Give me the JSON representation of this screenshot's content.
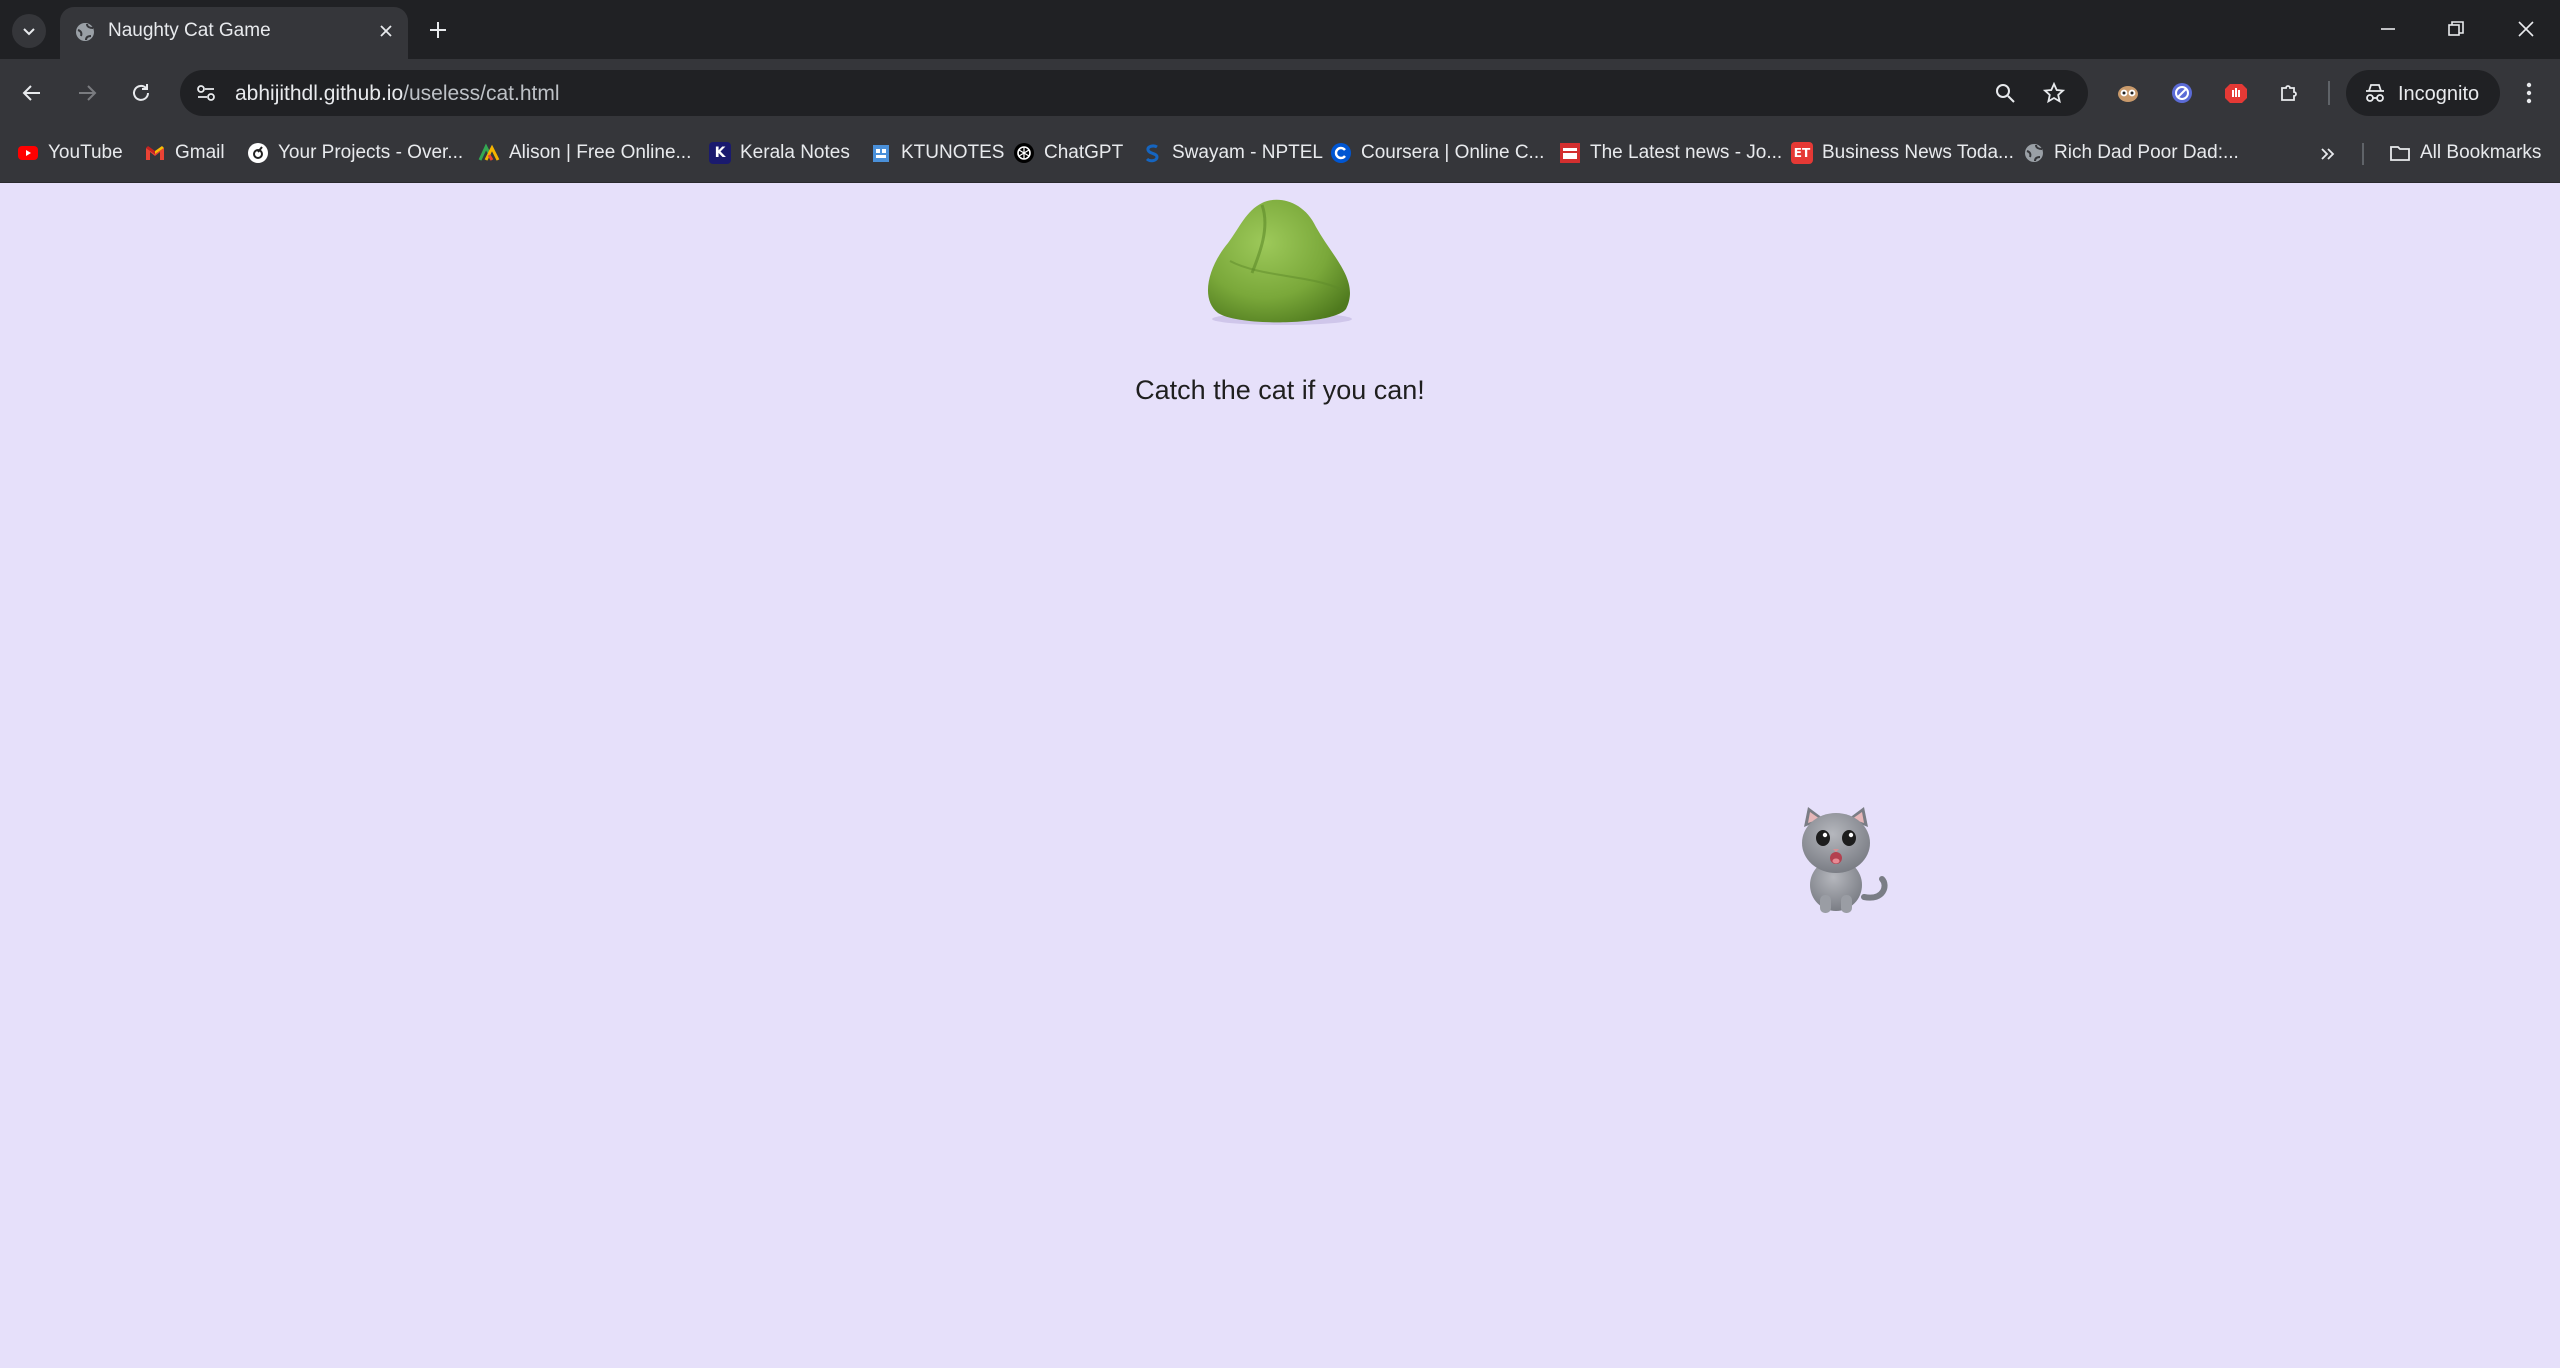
{
  "tab": {
    "title": "Naughty Cat Game"
  },
  "omnibox": {
    "domain": "abhijithdl.github.io",
    "path": "/useless/cat.html"
  },
  "incognito": {
    "label": "Incognito"
  },
  "bookmarks": [
    {
      "label": "YouTube",
      "icon": "youtube-icon",
      "color": "#ff0000"
    },
    {
      "label": "Gmail",
      "icon": "gmail-icon",
      "color": "#ea4335"
    },
    {
      "label": "Your Projects - Over...",
      "icon": "projects-icon",
      "color": "#ffffff"
    },
    {
      "label": "Alison | Free Online...",
      "icon": "alison-icon",
      "color": "#f4b400"
    },
    {
      "label": "Kerala Notes",
      "icon": "k-icon",
      "color": "#1a1a6e"
    },
    {
      "label": "KTUNOTES",
      "icon": "ktunotes-icon",
      "color": "#4a90d9"
    },
    {
      "label": "ChatGPT",
      "icon": "chatgpt-icon",
      "color": "#000000"
    },
    {
      "label": "Swayam - NPTEL",
      "icon": "swayam-icon",
      "color": "#1565c0"
    },
    {
      "label": "Coursera | Online C...",
      "icon": "coursera-icon",
      "color": "#0056d2"
    },
    {
      "label": "The Latest news - Jo...",
      "icon": "week-icon",
      "color": "#d32f2f"
    },
    {
      "label": "Business News Toda...",
      "icon": "et-icon",
      "color": "#e53935"
    },
    {
      "label": "Rich Dad Poor Dad:...",
      "icon": "globe-icon",
      "color": "#9aa0a6"
    }
  ],
  "all_bookmarks": {
    "label": "All Bookmarks"
  },
  "page": {
    "prompt": "Catch the cat if you can!",
    "background": "#e6e0fa"
  }
}
